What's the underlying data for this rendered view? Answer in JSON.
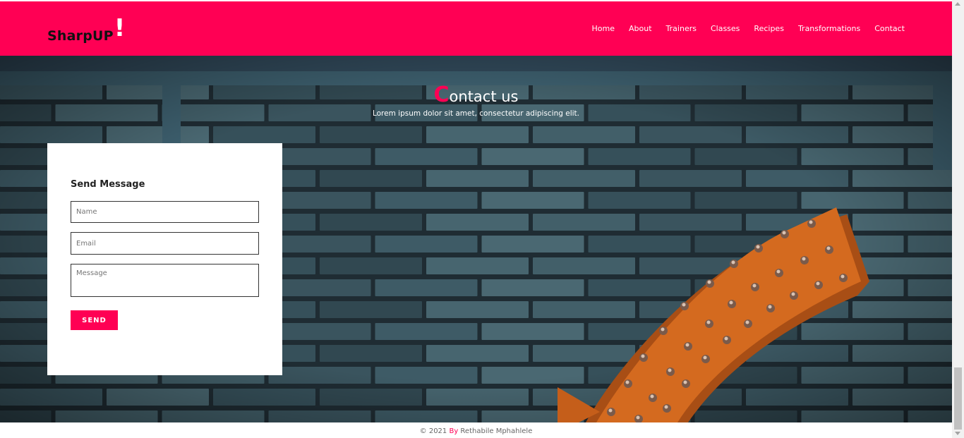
{
  "brand": {
    "name": "SharpUP",
    "mark": "!"
  },
  "nav": {
    "items": [
      "Home",
      "About",
      "Trainers",
      "Classes",
      "Recipes",
      "Transformations",
      "Contact"
    ]
  },
  "hero": {
    "title_first": "C",
    "title_rest": "ontact us",
    "subtitle": "Lorem ipsum dolor sit amet, consectetur adipiscing elit."
  },
  "form": {
    "title": "Send Message",
    "name_placeholder": "Name",
    "email_placeholder": "Email",
    "message_placeholder": "Message",
    "send_label": "SEND"
  },
  "footer": {
    "prefix": "© 2021 ",
    "by": "By",
    "author": " Rethabile Mphahlele"
  },
  "colors": {
    "accent": "#ff0054",
    "background": "#263941"
  }
}
